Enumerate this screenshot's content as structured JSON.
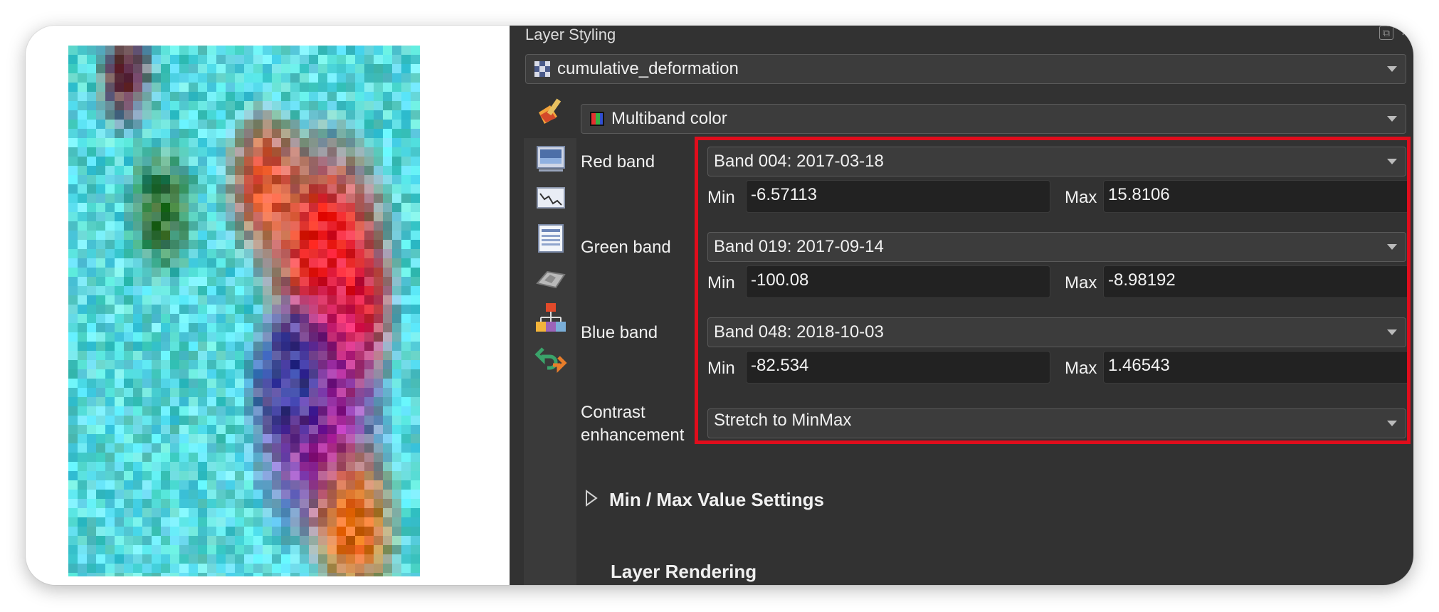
{
  "panel": {
    "title": "Layer Styling",
    "layer_name": "cumulative_deformation",
    "renderer": "Multiband color",
    "red": {
      "label": "Red band",
      "band": "Band 004: 2017-03-18",
      "min_label": "Min",
      "min": "-6.57113",
      "max_label": "Max",
      "max": "15.8106"
    },
    "green": {
      "label": "Green band",
      "band": "Band 019: 2017-09-14",
      "min_label": "Min",
      "min": "-100.08",
      "max_label": "Max",
      "max": "-8.98192"
    },
    "blue": {
      "label": "Blue band",
      "band": "Band 048: 2018-10-03",
      "min_label": "Min",
      "min": "-82.534",
      "max_label": "Max",
      "max": "1.46543"
    },
    "contrast_label_1": "Contrast",
    "contrast_label_2": "enhancement",
    "contrast_value": "Stretch to MinMax",
    "minmax_section": "Min / Max Value Settings",
    "rendering_section": "Layer Rendering"
  },
  "colors": {
    "panel_bg": "#323232",
    "highlight": "#e00d1c",
    "map_cyan": "#57d6dc"
  },
  "icons": [
    "layer-raster-icon",
    "paintbrush-icon",
    "histogram-icon",
    "transparency-icon",
    "metadata-icon",
    "3d-view-icon",
    "hierarchy-icon",
    "history-undo-icon",
    "float-icon",
    "close-icon"
  ]
}
